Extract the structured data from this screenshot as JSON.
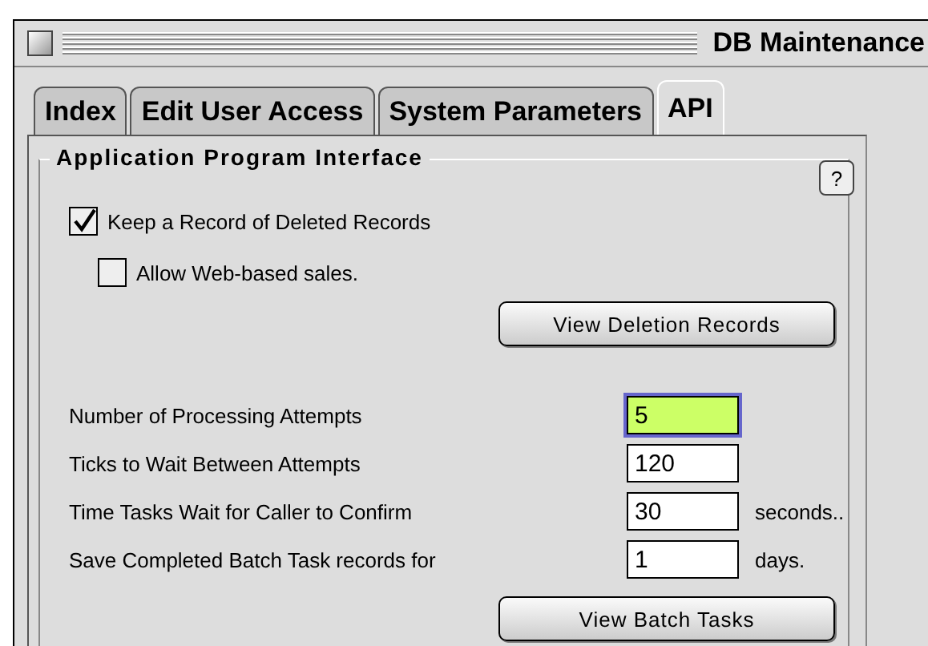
{
  "window": {
    "title": "DB Maintenance"
  },
  "tabs": [
    {
      "label": "Index",
      "selected": false
    },
    {
      "label": "Edit User Access",
      "selected": false
    },
    {
      "label": "System Parameters",
      "selected": false
    },
    {
      "label": "API",
      "selected": true
    }
  ],
  "group": {
    "title": "Application Program Interface",
    "help": "?"
  },
  "checkboxes": [
    {
      "label": "Keep a Record of Deleted Records",
      "checked": true,
      "children": [
        {
          "label": "Allow Web-based sales.",
          "checked": false
        }
      ]
    }
  ],
  "deletion_button": "View Deletion Records",
  "fields": [
    {
      "label": "Number of Processing Attempts",
      "value": "5",
      "focused": true
    },
    {
      "label": "Ticks to Wait Between Attempts",
      "value": "120",
      "focused": false
    },
    {
      "label": "Time Tasks Wait for Caller to Confirm",
      "value": "30",
      "focused": false,
      "suffix": "seconds.."
    },
    {
      "label": "Save Completed Batch Task records for",
      "value": "1",
      "focused": false,
      "suffix": "days."
    }
  ],
  "batch_button": "View Batch Tasks"
}
